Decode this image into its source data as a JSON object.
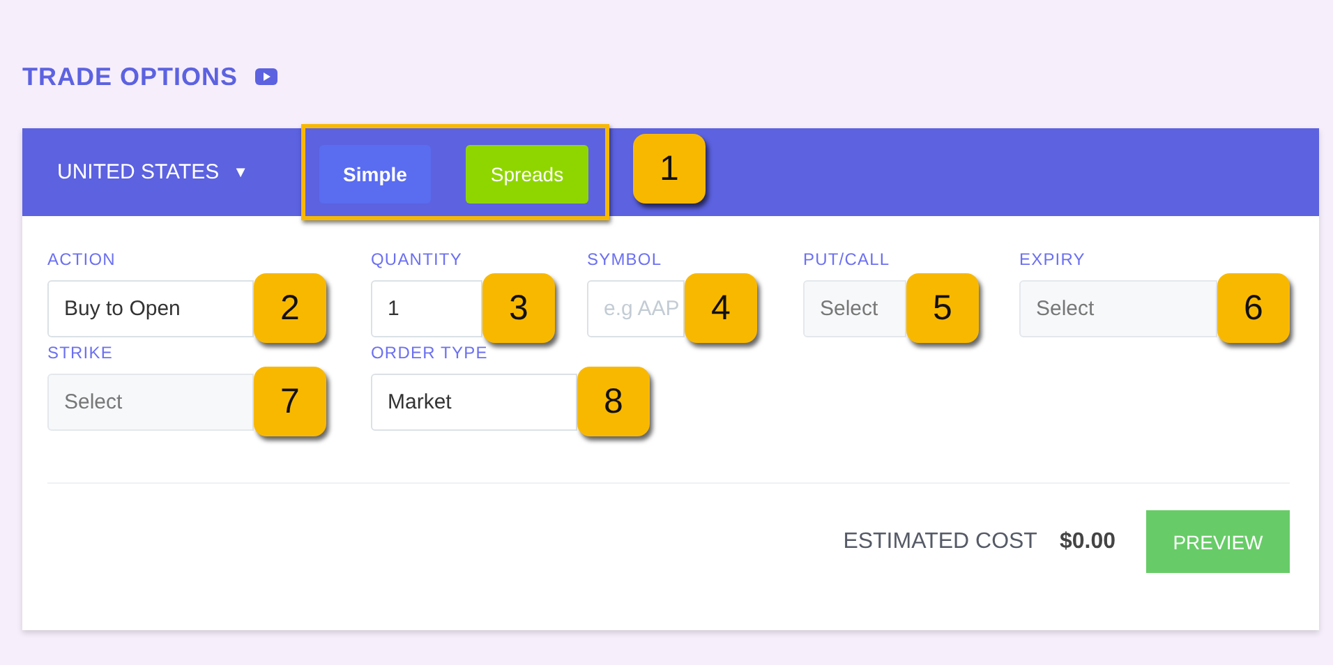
{
  "page": {
    "title": "TRADE OPTIONS"
  },
  "header": {
    "country": "UNITED STATES",
    "country_caret": "▼",
    "tabs_callout": "1",
    "tabs_highlighted": true,
    "tabs": [
      {
        "label": "Simple",
        "selected": false
      },
      {
        "label": "Spreads",
        "selected": true
      }
    ]
  },
  "rows": [
    [
      {
        "label": "ACTION",
        "value": "Buy to Open",
        "disabled": false,
        "callout": "2"
      },
      {
        "label": "QUANTITY",
        "value": "1",
        "disabled": false,
        "callout": "3"
      },
      {
        "label": "SYMBOL",
        "placeholder": "e.g AAP",
        "disabled": false,
        "callout": "4"
      },
      {
        "label": "PUT/CALL",
        "placeholder": "Select",
        "disabled": true,
        "callout": "5"
      },
      {
        "label": "EXPIRY",
        "placeholder": "Select",
        "disabled": true,
        "callout": "6"
      }
    ],
    [
      {
        "label": "STRIKE",
        "placeholder": "Select",
        "disabled": true,
        "callout": "7"
      },
      {
        "label": "ORDER TYPE",
        "value": "Market",
        "disabled": false,
        "callout": "8"
      }
    ]
  ],
  "footer": {
    "cost_label": "ESTIMATED COST",
    "cost_value": "$0.00",
    "button": "PREVIEW"
  }
}
